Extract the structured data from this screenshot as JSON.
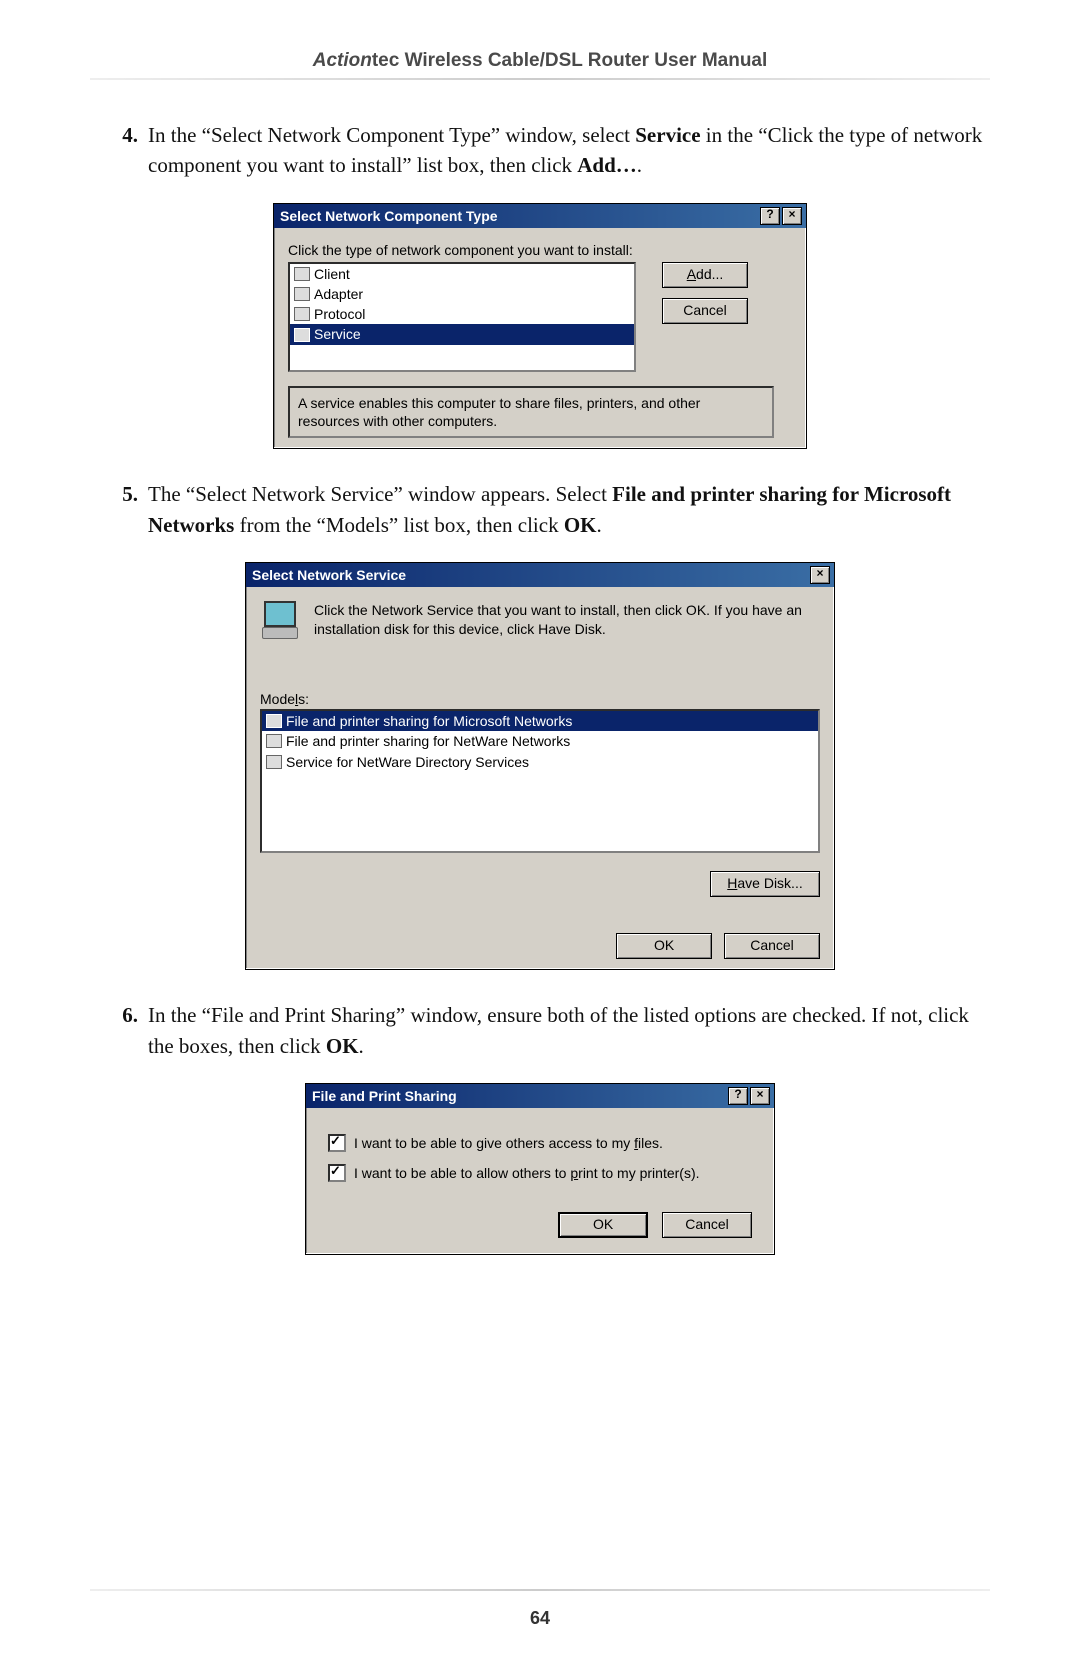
{
  "header": {
    "brand": "Action",
    "brand_suffix": "tec",
    "rest": " Wireless Cable/DSL Router User Manual"
  },
  "page_number": "64",
  "steps": {
    "s4": {
      "num": "4.",
      "text_before": "In the “Select Network Component Type” window, select ",
      "bold1": "Service",
      "text_mid": " in the “Click the type of network component you want to install” list box, then click ",
      "bold2": "Add…",
      "text_after": "."
    },
    "s5": {
      "num": "5.",
      "text_before": "The “Select Network Service” window appears. Select ",
      "bold1": "File and printer sharing for Microsoft Networks",
      "text_mid": " from the “Models” list box, then click ",
      "bold2": "OK",
      "text_after": "."
    },
    "s6": {
      "num": "6.",
      "text_before": "In the “File and Print Sharing” window, ensure both of the listed options are checked. If not, click the boxes, then click ",
      "bold1": "OK",
      "text_after": "."
    }
  },
  "dlg1": {
    "title": "Select Network Component Type",
    "help_btn": "?",
    "close_btn": "×",
    "prompt": "Click the type of network component you want to install:",
    "items": [
      "Client",
      "Adapter",
      "Protocol",
      "Service"
    ],
    "selected_index": 3,
    "add_btn": "Add...",
    "cancel_btn": "Cancel",
    "description": "A service enables this computer to share files, printers, and other resources with other computers."
  },
  "dlg2": {
    "title": "Select Network Service",
    "close_btn": "×",
    "instr": "Click the Network Service that you want to install, then click OK. If you have an installation disk for this device, click Have Disk.",
    "models_label_pre": "Mode",
    "models_label_u": "l",
    "models_label_post": "s:",
    "items": [
      "File and printer sharing for Microsoft Networks",
      "File and printer sharing for NetWare Networks",
      "Service for NetWare Directory Services"
    ],
    "selected_index": 0,
    "havedisk_btn": "Have Disk...",
    "ok_btn": "OK",
    "cancel_btn": "Cancel"
  },
  "dlg3": {
    "title": "File and Print Sharing",
    "help_btn": "?",
    "close_btn": "×",
    "opt1_pre": "I want to be able to give others access to my ",
    "opt1_u": "f",
    "opt1_post": "iles.",
    "opt2_pre": "I want to be able to allow others to ",
    "opt2_u": "p",
    "opt2_post": "rint to my printer(s).",
    "ok_btn": "OK",
    "cancel_btn": "Cancel"
  }
}
